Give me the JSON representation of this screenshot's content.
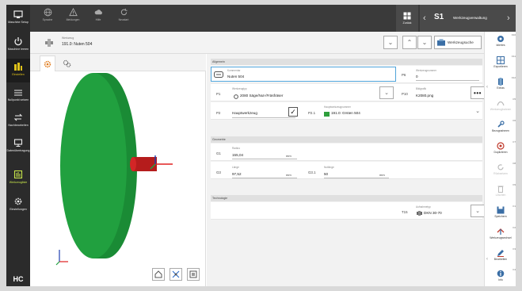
{
  "sidebar_left": {
    "items": [
      {
        "icon": "machine-icon",
        "label": "Maschine Setup"
      },
      {
        "icon": "power-icon",
        "label": "Maschine leeren"
      },
      {
        "icon": "tool-magazine-icon",
        "label": "Einstellen"
      },
      {
        "icon": "setup-bars-icon",
        "label": "Nullpunkt setzen"
      },
      {
        "icon": "transfer-icon",
        "label": "Nachbearbeiten"
      },
      {
        "icon": "monitor-icon",
        "label": "Datenübertragung"
      },
      {
        "icon": "tool-list-icon",
        "label": "Werkzeugliste"
      },
      {
        "icon": "settings-gear-icon",
        "label": "Einstellungen"
      }
    ],
    "logo": "HC"
  },
  "toolbar": {
    "buttons": [
      {
        "icon": "globe-icon",
        "label": "Sprache"
      },
      {
        "icon": "warning-icon",
        "label": "Meldungen"
      },
      {
        "icon": "cloud-icon",
        "label": "Hilfe"
      },
      {
        "icon": "refresh-icon",
        "label": "Neustart"
      }
    ],
    "back_label": "Zurück",
    "app_logo": "S1",
    "app_title": "Werkzeugverwaltung"
  },
  "header": {
    "caption": "Werkzeug",
    "value": "191.0: Nuten 504",
    "search_label": "Werkzeugsuche"
  },
  "sidebar_right": {
    "items": [
      {
        "icon": "tool-data-icon",
        "label": "Idiertes",
        "key": "F10",
        "dim": false
      },
      {
        "icon": "grid-tools-icon",
        "label": "Exportieren",
        "key": "F11",
        "dim": false
      },
      {
        "icon": "tool-blue-icon",
        "label": "Extras",
        "key": "F12",
        "dim": false
      },
      {
        "icon": "curve-icon",
        "label": "Werkzeugbahnen",
        "key": "F5",
        "dim": true
      },
      {
        "icon": "wrench-icon",
        "label": "Bezugnahmen",
        "key": "F6",
        "dim": false
      },
      {
        "icon": "duplicate-icon",
        "label": "Duplizieren",
        "key": "F7",
        "dim": false
      },
      {
        "icon": "reset-icon",
        "label": "Rücksetzen",
        "key": "F8",
        "dim": true
      },
      {
        "icon": "delete-icon",
        "label": "Löschen",
        "key": "F9",
        "dim": true
      },
      {
        "icon": "save-icon",
        "label": "Speichern",
        "key": "F1",
        "dim": false
      },
      {
        "icon": "tool-change-icon",
        "label": "Werkzeugwechsel",
        "key": "F2",
        "dim": false
      },
      {
        "icon": "edit-icon",
        "label": "Bearbeiten",
        "key": "F3",
        "dim": false
      },
      {
        "icon": "info-icon",
        "label": "Info",
        "key": "F4",
        "dim": false
      }
    ]
  },
  "form": {
    "sections": {
      "general": "Allgemein",
      "geometry": "Geometrie",
      "technology": "Technologie"
    },
    "name": {
      "caption": "Kommentar",
      "value": "Nuten 504"
    },
    "p6": {
      "id": "P6",
      "caption": "Werkzeugnummer",
      "value": "0"
    },
    "p1": {
      "id": "P1",
      "caption": "Werkzeugtyp",
      "value": "2080 Säge/Nut-/Fräsfräser"
    },
    "p10": {
      "id": "P10",
      "caption": "Bildgrafik",
      "value": "K2080.png"
    },
    "p2": {
      "id": "P2",
      "value": "Hauptwerkzeug",
      "checked": true
    },
    "p21": {
      "id": "P2.1",
      "caption": "Hauptwerkzeugnummer",
      "value": "191.0: Grsten 504"
    },
    "g1": {
      "id": "G1",
      "caption": "Radius",
      "value": "155,04",
      "unit": "mm"
    },
    "g3": {
      "id": "G3",
      "caption": "Länge",
      "value": "97,52",
      "unit": "mm"
    },
    "g31": {
      "id": "G3.1",
      "caption": "Nutlänge",
      "value": "50",
      "unit": "mm"
    },
    "t15": {
      "id": "T15",
      "caption": "Aufnahmetyp",
      "value": "DKN 30-70"
    }
  },
  "colors": {
    "accent_yellow": "#e0c21a",
    "accent_green": "#c8e64b",
    "tool_green": "#1e9e3c",
    "spindle_red": "#cc1f1f",
    "dark_sidebar": "#2b2b2b"
  }
}
